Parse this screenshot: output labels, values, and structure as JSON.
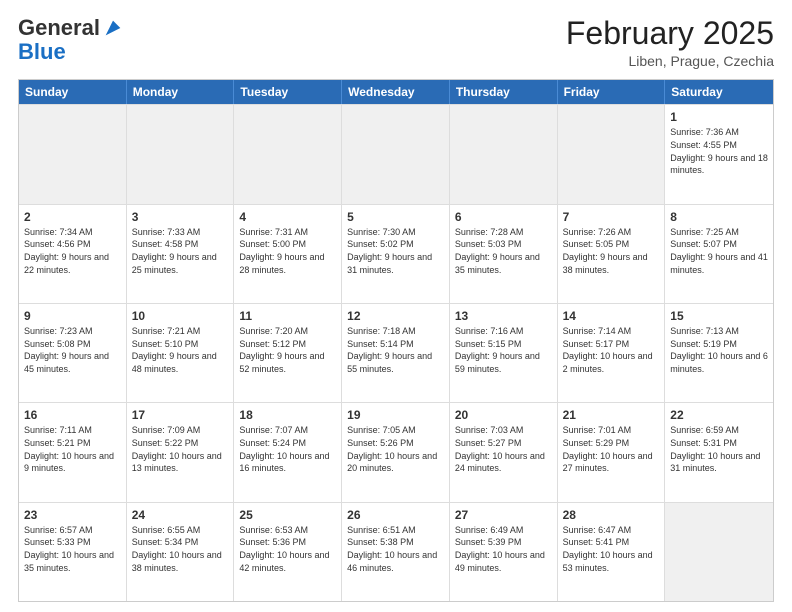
{
  "header": {
    "logo_general": "General",
    "logo_blue": "Blue",
    "month_title": "February 2025",
    "location": "Liben, Prague, Czechia"
  },
  "weekdays": [
    "Sunday",
    "Monday",
    "Tuesday",
    "Wednesday",
    "Thursday",
    "Friday",
    "Saturday"
  ],
  "rows": [
    [
      {
        "day": "",
        "text": "",
        "shaded": true
      },
      {
        "day": "",
        "text": "",
        "shaded": true
      },
      {
        "day": "",
        "text": "",
        "shaded": true
      },
      {
        "day": "",
        "text": "",
        "shaded": true
      },
      {
        "day": "",
        "text": "",
        "shaded": true
      },
      {
        "day": "",
        "text": "",
        "shaded": true
      },
      {
        "day": "1",
        "text": "Sunrise: 7:36 AM\nSunset: 4:55 PM\nDaylight: 9 hours and 18 minutes.",
        "shaded": false
      }
    ],
    [
      {
        "day": "2",
        "text": "Sunrise: 7:34 AM\nSunset: 4:56 PM\nDaylight: 9 hours and 22 minutes.",
        "shaded": false
      },
      {
        "day": "3",
        "text": "Sunrise: 7:33 AM\nSunset: 4:58 PM\nDaylight: 9 hours and 25 minutes.",
        "shaded": false
      },
      {
        "day": "4",
        "text": "Sunrise: 7:31 AM\nSunset: 5:00 PM\nDaylight: 9 hours and 28 minutes.",
        "shaded": false
      },
      {
        "day": "5",
        "text": "Sunrise: 7:30 AM\nSunset: 5:02 PM\nDaylight: 9 hours and 31 minutes.",
        "shaded": false
      },
      {
        "day": "6",
        "text": "Sunrise: 7:28 AM\nSunset: 5:03 PM\nDaylight: 9 hours and 35 minutes.",
        "shaded": false
      },
      {
        "day": "7",
        "text": "Sunrise: 7:26 AM\nSunset: 5:05 PM\nDaylight: 9 hours and 38 minutes.",
        "shaded": false
      },
      {
        "day": "8",
        "text": "Sunrise: 7:25 AM\nSunset: 5:07 PM\nDaylight: 9 hours and 41 minutes.",
        "shaded": false
      }
    ],
    [
      {
        "day": "9",
        "text": "Sunrise: 7:23 AM\nSunset: 5:08 PM\nDaylight: 9 hours and 45 minutes.",
        "shaded": false
      },
      {
        "day": "10",
        "text": "Sunrise: 7:21 AM\nSunset: 5:10 PM\nDaylight: 9 hours and 48 minutes.",
        "shaded": false
      },
      {
        "day": "11",
        "text": "Sunrise: 7:20 AM\nSunset: 5:12 PM\nDaylight: 9 hours and 52 minutes.",
        "shaded": false
      },
      {
        "day": "12",
        "text": "Sunrise: 7:18 AM\nSunset: 5:14 PM\nDaylight: 9 hours and 55 minutes.",
        "shaded": false
      },
      {
        "day": "13",
        "text": "Sunrise: 7:16 AM\nSunset: 5:15 PM\nDaylight: 9 hours and 59 minutes.",
        "shaded": false
      },
      {
        "day": "14",
        "text": "Sunrise: 7:14 AM\nSunset: 5:17 PM\nDaylight: 10 hours and 2 minutes.",
        "shaded": false
      },
      {
        "day": "15",
        "text": "Sunrise: 7:13 AM\nSunset: 5:19 PM\nDaylight: 10 hours and 6 minutes.",
        "shaded": false
      }
    ],
    [
      {
        "day": "16",
        "text": "Sunrise: 7:11 AM\nSunset: 5:21 PM\nDaylight: 10 hours and 9 minutes.",
        "shaded": false
      },
      {
        "day": "17",
        "text": "Sunrise: 7:09 AM\nSunset: 5:22 PM\nDaylight: 10 hours and 13 minutes.",
        "shaded": false
      },
      {
        "day": "18",
        "text": "Sunrise: 7:07 AM\nSunset: 5:24 PM\nDaylight: 10 hours and 16 minutes.",
        "shaded": false
      },
      {
        "day": "19",
        "text": "Sunrise: 7:05 AM\nSunset: 5:26 PM\nDaylight: 10 hours and 20 minutes.",
        "shaded": false
      },
      {
        "day": "20",
        "text": "Sunrise: 7:03 AM\nSunset: 5:27 PM\nDaylight: 10 hours and 24 minutes.",
        "shaded": false
      },
      {
        "day": "21",
        "text": "Sunrise: 7:01 AM\nSunset: 5:29 PM\nDaylight: 10 hours and 27 minutes.",
        "shaded": false
      },
      {
        "day": "22",
        "text": "Sunrise: 6:59 AM\nSunset: 5:31 PM\nDaylight: 10 hours and 31 minutes.",
        "shaded": false
      }
    ],
    [
      {
        "day": "23",
        "text": "Sunrise: 6:57 AM\nSunset: 5:33 PM\nDaylight: 10 hours and 35 minutes.",
        "shaded": false
      },
      {
        "day": "24",
        "text": "Sunrise: 6:55 AM\nSunset: 5:34 PM\nDaylight: 10 hours and 38 minutes.",
        "shaded": false
      },
      {
        "day": "25",
        "text": "Sunrise: 6:53 AM\nSunset: 5:36 PM\nDaylight: 10 hours and 42 minutes.",
        "shaded": false
      },
      {
        "day": "26",
        "text": "Sunrise: 6:51 AM\nSunset: 5:38 PM\nDaylight: 10 hours and 46 minutes.",
        "shaded": false
      },
      {
        "day": "27",
        "text": "Sunrise: 6:49 AM\nSunset: 5:39 PM\nDaylight: 10 hours and 49 minutes.",
        "shaded": false
      },
      {
        "day": "28",
        "text": "Sunrise: 6:47 AM\nSunset: 5:41 PM\nDaylight: 10 hours and 53 minutes.",
        "shaded": false
      },
      {
        "day": "",
        "text": "",
        "shaded": true
      }
    ]
  ]
}
